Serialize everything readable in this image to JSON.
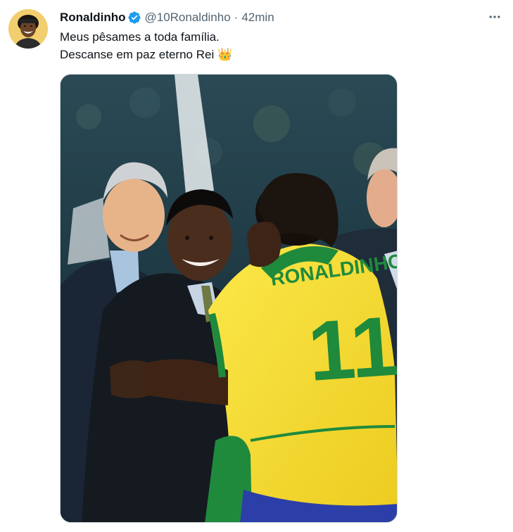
{
  "tweet": {
    "author_name": "Ronaldinho",
    "handle": "@10Ronaldinho",
    "separator": "·",
    "time": "42min",
    "lines": [
      "Meus pêsames a toda família.",
      "Descanse em paz eterno Rei"
    ],
    "emoji": "👑",
    "photo": {
      "jersey_name": "RONALDINHO",
      "jersey_number": "11"
    }
  },
  "colors": {
    "verified": "#1d9bf0",
    "secondary_text": "#536471",
    "primary_text": "#0f1419",
    "jersey_yellow": "#f6dc2a",
    "jersey_green": "#1f8a3c"
  },
  "icons": {
    "verified": "verified-badge-icon",
    "more": "more-options-icon"
  }
}
